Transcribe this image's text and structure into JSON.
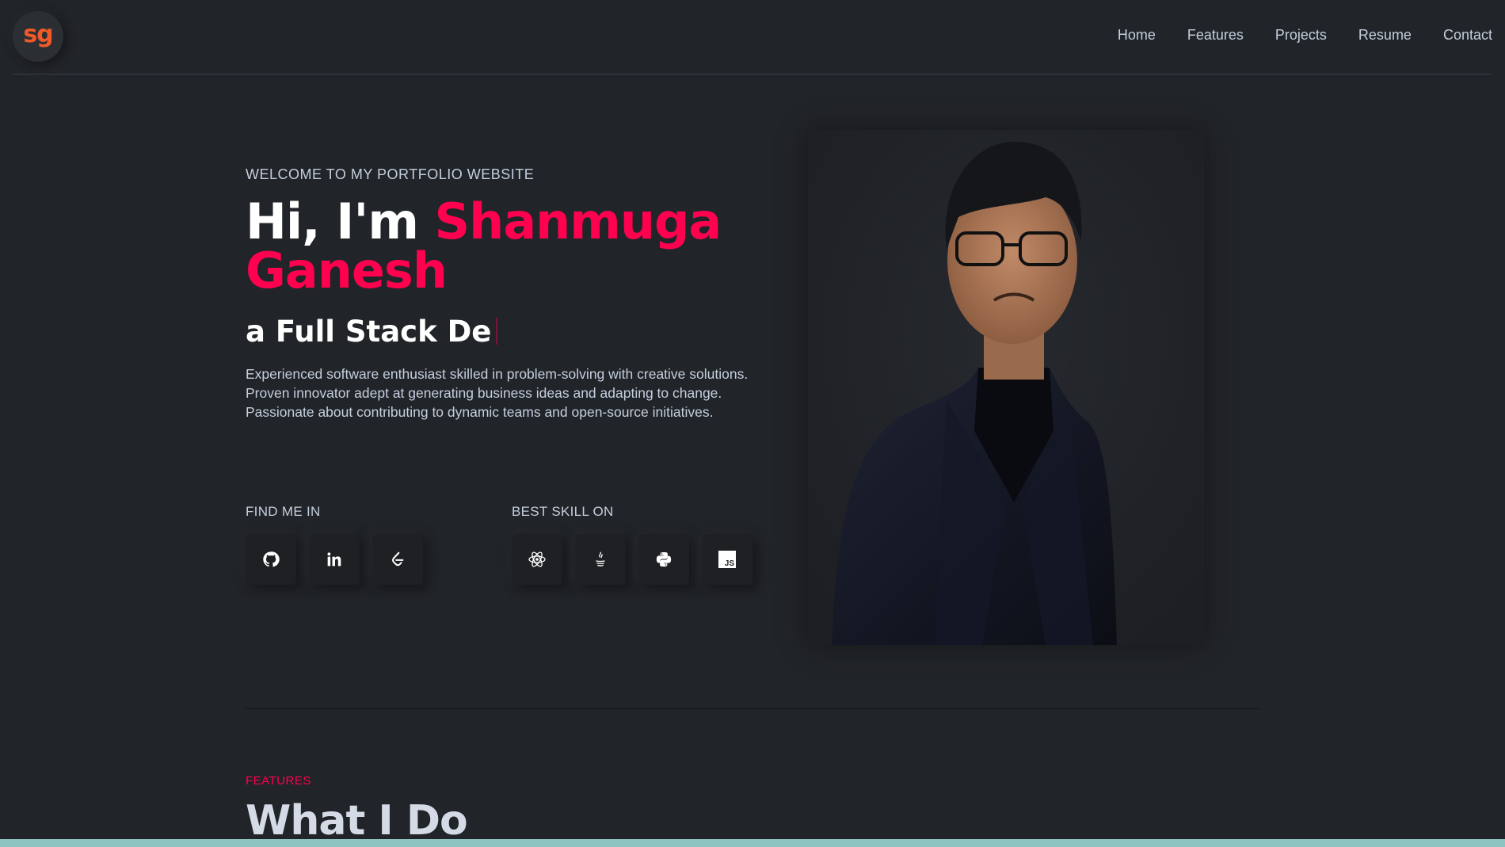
{
  "header": {
    "logo_text": "sg",
    "nav": [
      "Home",
      "Features",
      "Projects",
      "Resume",
      "Contact"
    ]
  },
  "hero": {
    "welcome": "WELCOME TO MY PORTFOLIO WEBSITE",
    "greeting": "Hi, I'm ",
    "name_line1": "Shanmuga",
    "name_line2": "Ganesh",
    "role": "a Full Stack De",
    "description": "Experienced software enthusiast skilled in problem-solving with creative solutions. Proven innovator adept at generating business ideas and adapting to change. Passionate about contributing to dynamic teams and open-source initiatives."
  },
  "find_me": {
    "title": "FIND ME IN",
    "icons": [
      "github-icon",
      "linkedin-icon",
      "leetcode-icon"
    ]
  },
  "skills": {
    "title": "BEST SKILL ON",
    "icons": [
      "react-icon",
      "java-icon",
      "python-icon",
      "javascript-icon"
    ],
    "js_label": "JS"
  },
  "features": {
    "label": "FEATURES",
    "title": "What I Do"
  },
  "colors": {
    "background": "#212428",
    "accent": "#ff014f",
    "logo": "#f05a28",
    "text": "#c4cfde"
  }
}
